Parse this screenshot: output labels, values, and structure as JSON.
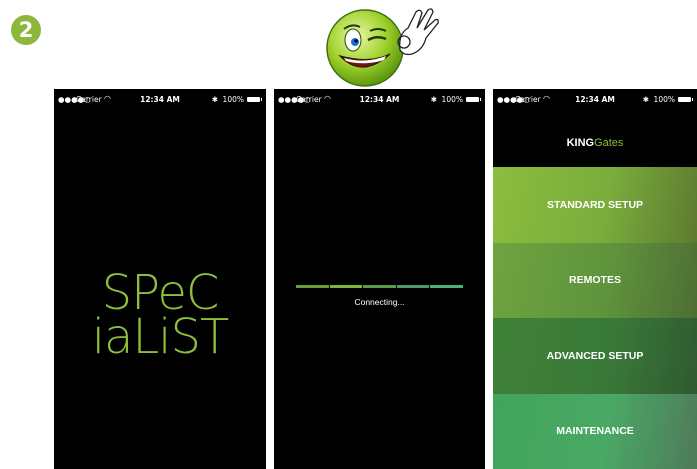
{
  "step": {
    "number": "2"
  },
  "status_bar": {
    "signal": "●●●●○",
    "carrier": "Carrier",
    "time": "12:34 AM",
    "battery": "100%"
  },
  "splash": {
    "logo_line1": "SPeC",
    "logo_line2": "iaLiST"
  },
  "connecting": {
    "text": "Connecting...",
    "progress_segments": [
      "#6b9a3a",
      "#7fb33f",
      "#5f9a4a",
      "#4d9a6a",
      "#4fae7d"
    ]
  },
  "menu_screen": {
    "brand_bold": "KING",
    "brand_light": "Gates",
    "items": [
      {
        "label": "STANDARD SETUP"
      },
      {
        "label": "REMOTES"
      },
      {
        "label": "ADVANCED SETUP"
      },
      {
        "label": "MAINTENANCE"
      }
    ]
  },
  "colors": {
    "accent": "#8cbf3b",
    "badge": "#8cb63c"
  }
}
